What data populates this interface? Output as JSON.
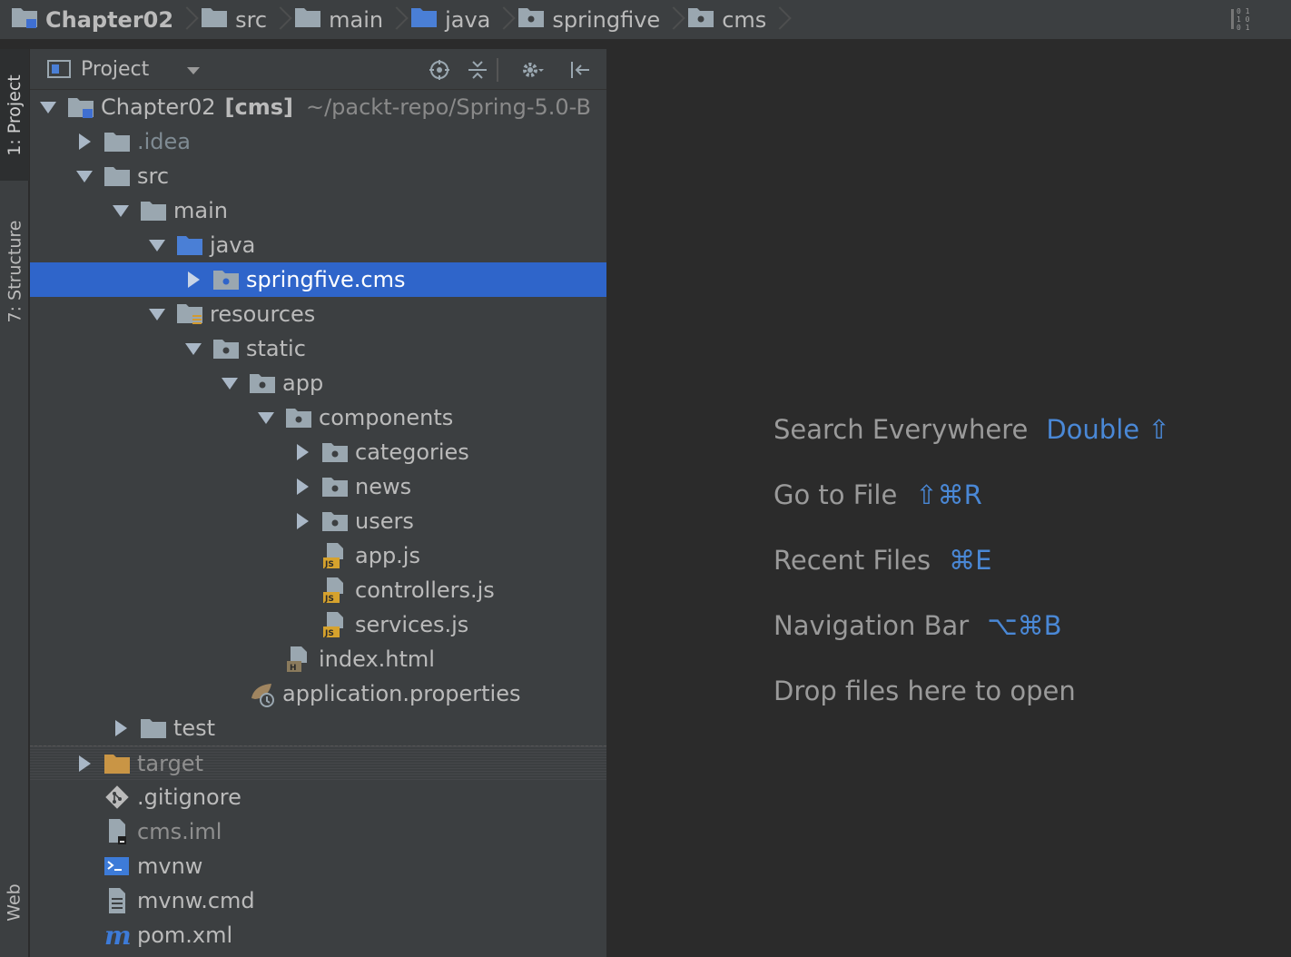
{
  "breadcrumb": [
    {
      "label": "Chapter02",
      "icon": "module-folder-icon"
    },
    {
      "label": "src",
      "icon": "folder-icon"
    },
    {
      "label": "main",
      "icon": "folder-icon"
    },
    {
      "label": "java",
      "icon": "source-folder-icon"
    },
    {
      "label": "springfive",
      "icon": "package-icon"
    },
    {
      "label": "cms",
      "icon": "package-icon"
    }
  ],
  "binary_icon": [
    "0 1",
    "1 0",
    "0 1"
  ],
  "tool_strip": {
    "project": "1: Project",
    "structure": "7: Structure",
    "web": "Web"
  },
  "panel": {
    "title": "Project"
  },
  "tree": {
    "root": {
      "name": "Chapter02",
      "module": "[cms]",
      "path": "~/packt-repo/Spring-5.0-B"
    },
    "items": [
      {
        "label": ".idea"
      },
      {
        "label": "src"
      },
      {
        "label": "main"
      },
      {
        "label": "java"
      },
      {
        "label": "springfive.cms"
      },
      {
        "label": "resources"
      },
      {
        "label": "static"
      },
      {
        "label": "app"
      },
      {
        "label": "components"
      },
      {
        "label": "categories"
      },
      {
        "label": "news"
      },
      {
        "label": "users"
      },
      {
        "label": "app.js"
      },
      {
        "label": "controllers.js"
      },
      {
        "label": "services.js"
      },
      {
        "label": "index.html"
      },
      {
        "label": "application.properties"
      },
      {
        "label": "test"
      },
      {
        "label": "target"
      },
      {
        "label": ".gitignore"
      },
      {
        "label": "cms.iml"
      },
      {
        "label": "mvnw"
      },
      {
        "label": "mvnw.cmd"
      },
      {
        "label": "pom.xml"
      }
    ]
  },
  "editor_hints": [
    {
      "label": "Search Everywhere",
      "key": "Double ⇧"
    },
    {
      "label": "Go to File",
      "key": "⇧⌘R"
    },
    {
      "label": "Recent Files",
      "key": "⌘E"
    },
    {
      "label": "Navigation Bar",
      "key": "⌥⌘B"
    },
    {
      "label": "Drop files here to open",
      "key": ""
    }
  ],
  "colors": {
    "selection": "#2f65ca",
    "accent_key": "#4a88d6",
    "panel_bg": "#3c3f41",
    "editor_bg": "#2b2b2b"
  }
}
